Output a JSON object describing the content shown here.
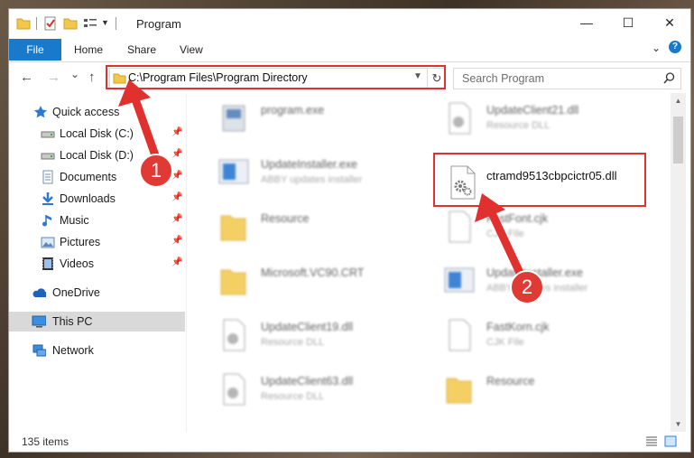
{
  "window": {
    "title": "Program",
    "minimize_glyph": "—",
    "maximize_glyph": "☐",
    "close_glyph": "✕"
  },
  "ribbon": {
    "tabs": [
      {
        "label": "File"
      },
      {
        "label": "Home"
      },
      {
        "label": "Share"
      },
      {
        "label": "View"
      }
    ],
    "expand_glyph": "⌄",
    "help_glyph": "?"
  },
  "navigation": {
    "back_glyph": "←",
    "forward_glyph": "→",
    "recent_glyph": "⌄",
    "up_glyph": "↑",
    "address": "C:\\Program Files\\Program Directory",
    "refresh_glyph": "↻",
    "search_placeholder": "Search Program",
    "search_glyph": "⚲"
  },
  "sidebar": {
    "pin_glyph": "📌",
    "items": [
      {
        "label": "Quick access",
        "icon": "star-icon"
      },
      {
        "label": "Local Disk (C:)",
        "icon": "drive-icon"
      },
      {
        "label": "Local Disk (D:)",
        "icon": "drive-icon"
      },
      {
        "label": "Documents",
        "icon": "documents-icon"
      },
      {
        "label": "Downloads",
        "icon": "download-icon"
      },
      {
        "label": "Music",
        "icon": "music-icon"
      },
      {
        "label": "Pictures",
        "icon": "pictures-icon"
      },
      {
        "label": "Videos",
        "icon": "videos-icon"
      },
      {
        "label": "OneDrive",
        "icon": "cloud-icon"
      },
      {
        "label": "This PC",
        "icon": "pc-icon"
      },
      {
        "label": "Network",
        "icon": "network-icon"
      }
    ]
  },
  "files": [
    {
      "name": "program.exe",
      "desc": "",
      "icon": "exe-icon"
    },
    {
      "name": "UpdateClient21.dll",
      "desc": "Resource DLL",
      "icon": "dll-icon"
    },
    {
      "name": "UpdateInstaller.exe",
      "desc": "ABBY updates installer",
      "icon": "installer-icon"
    },
    {
      "name": "Resource",
      "desc": "",
      "icon": "folder-icon"
    },
    {
      "name": "FastFont.cjk",
      "desc": "CJK File",
      "icon": "file-icon"
    },
    {
      "name": "Microsoft.VC90.CRT",
      "desc": "",
      "icon": "folder-icon"
    },
    {
      "name": "UpdateInstaller.exe",
      "desc": "ABBY updates installer",
      "icon": "installer-icon"
    },
    {
      "name": "UpdateClient19.dll",
      "desc": "Resource DLL",
      "icon": "dll-icon"
    },
    {
      "name": "FastKorn.cjk",
      "desc": "CJK File",
      "icon": "file-icon"
    },
    {
      "name": "UpdateClient63.dll",
      "desc": "Resource DLL",
      "icon": "dll-icon"
    },
    {
      "name": "Resource",
      "desc": "",
      "icon": "folder-icon"
    }
  ],
  "highlighted_file": {
    "name": "ctramd9513cbpcictr05.dll",
    "icon": "dll-gear-icon"
  },
  "status": {
    "item_count": "135 items"
  },
  "annotations": {
    "step1": "1",
    "step2": "2",
    "color": "#e0312f"
  }
}
